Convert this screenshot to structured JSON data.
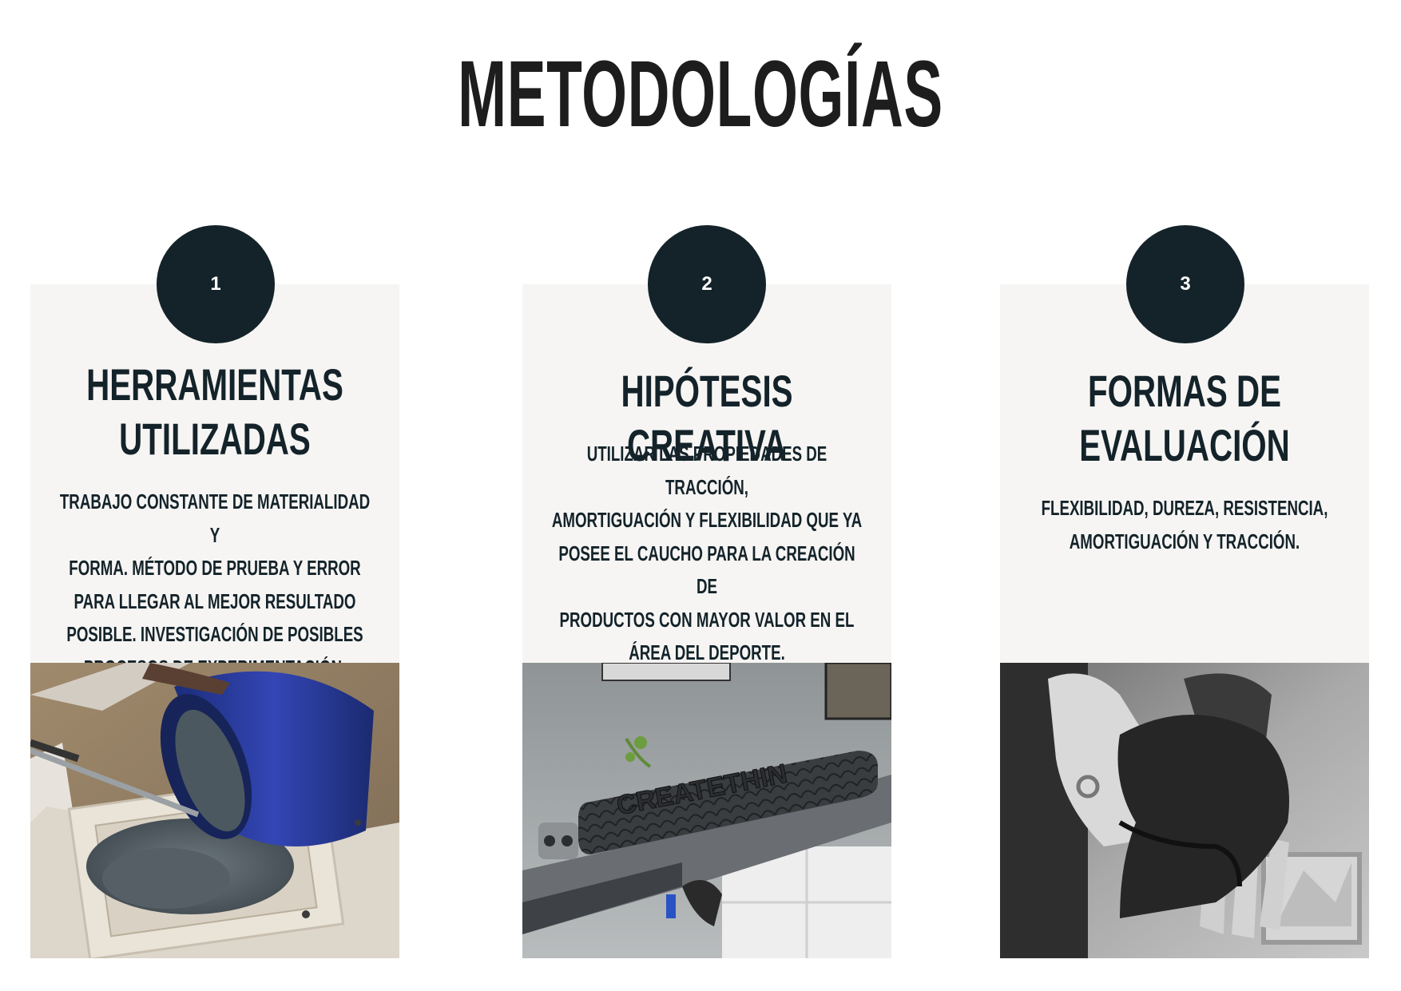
{
  "page": {
    "title": "METODOLOGÍAS"
  },
  "cards": [
    {
      "number": "1",
      "heading": "HERRAMIENTAS\nUTILIZADAS",
      "body": "TRABAJO CONSTANTE DE MATERIALIDAD Y\nFORMA. MÉTODO DE PRUEBA Y ERROR\nPARA LLEGAR AL MEJOR RESULTADO\nPOSIBLE. INVESTIGACIÓN DE POSIBLES\nPROCESOS DE EXPERIMENTACIÓN.",
      "photo_subject": "blue bucket pouring rubber granulate into a mold"
    },
    {
      "number": "2",
      "heading": "HIPÓTESIS CREATIVA",
      "body": "UTILIZAR LAS PROPIEDADES DE TRACCIÓN,\nAMORTIGUACIÓN Y FLEXIBILIDAD QUE YA\nPOSEE EL CAUCHO PARA LA CREACIÓN DE\nPRODUCTOS CON MAYOR VALOR EN EL\nÁREA DEL DEPORTE.",
      "photo_subject": "textured rubber bicycle grip on handlebar",
      "photo_text": "CREATETHIN"
    },
    {
      "number": "3",
      "heading": "FORMAS DE\nEVALUACIÓN",
      "body": "FLEXIBILIDAD, DUREZA, RESISTENCIA,\nAMORTIGUACIÓN Y TRACCIÓN.",
      "photo_subject": "hand bending a flexible rubber piece"
    }
  ],
  "colors": {
    "dark_accent": "#14232a",
    "panel_background": "#f6f5f3",
    "page_background": "#ffffff"
  }
}
